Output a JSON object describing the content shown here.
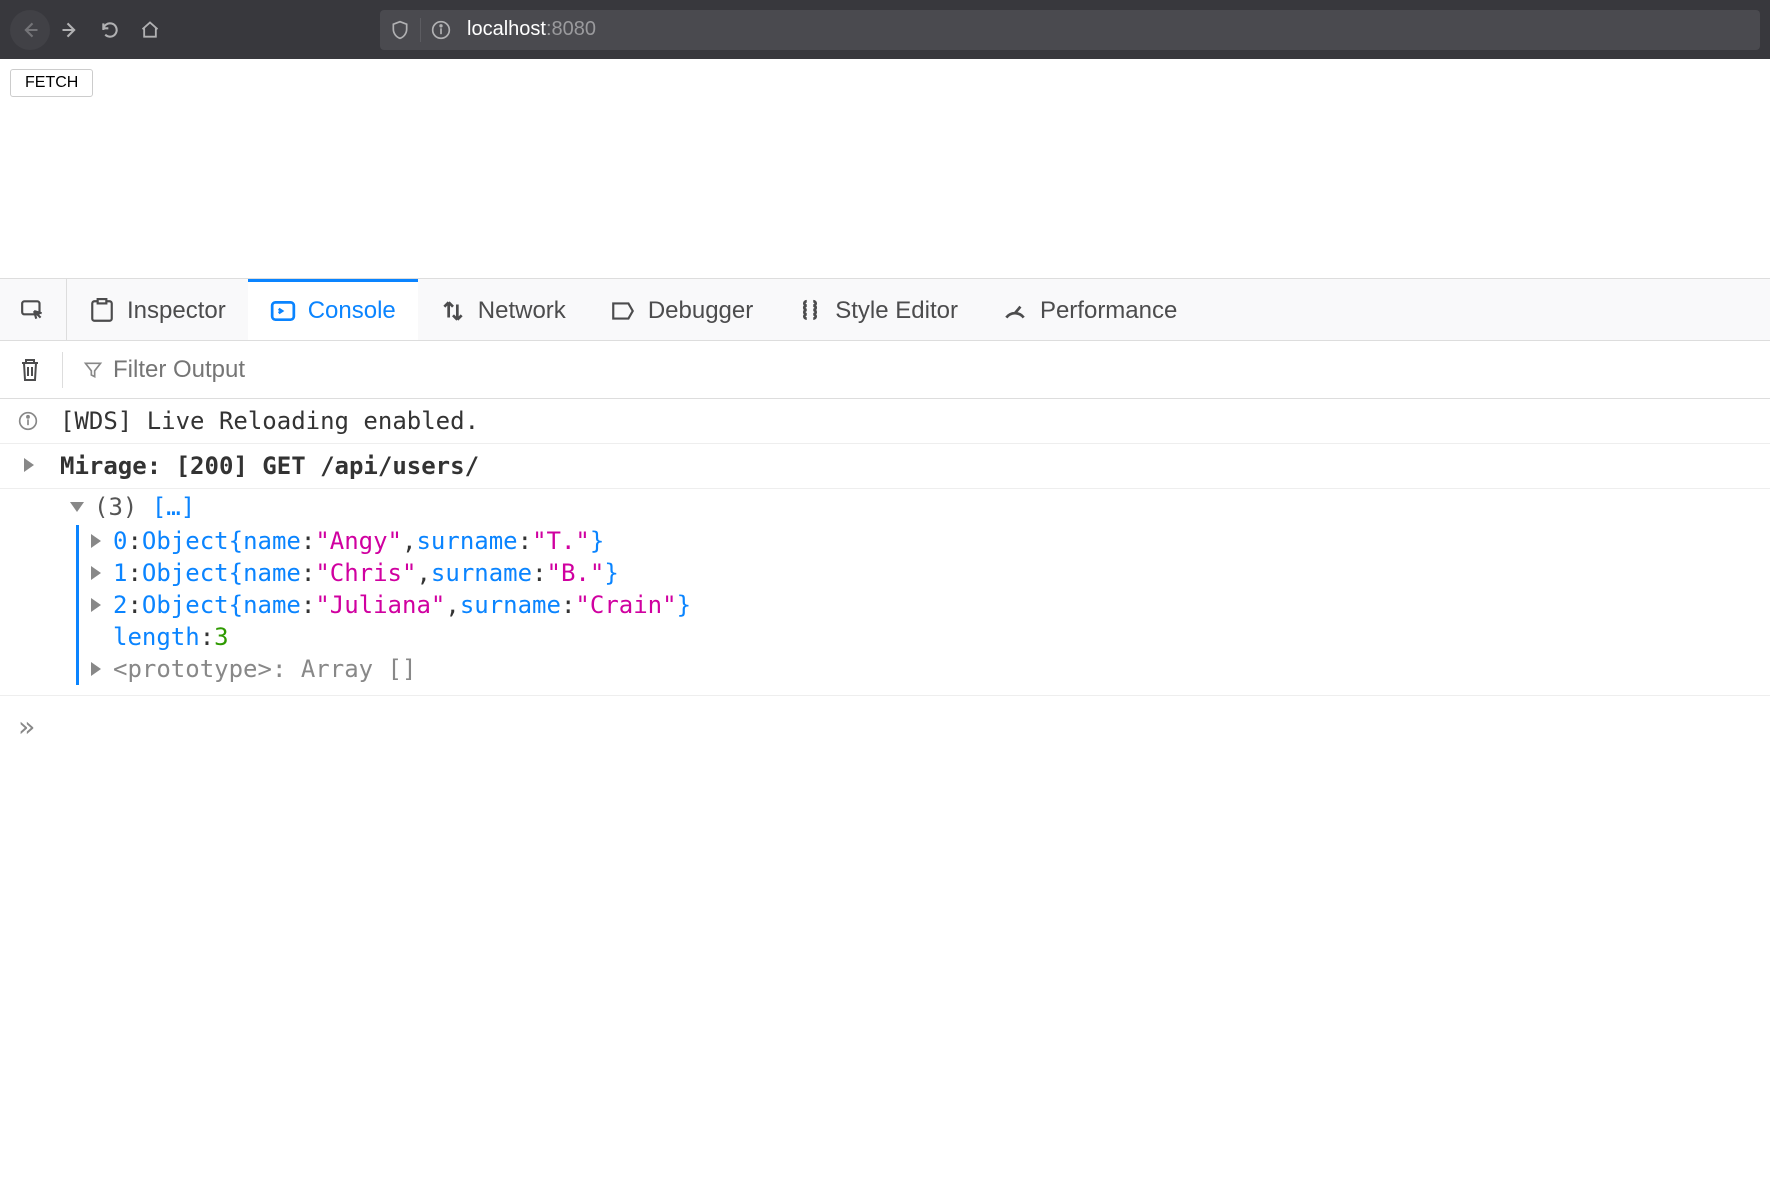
{
  "browser": {
    "url_host": "localhost",
    "url_port": ":8080"
  },
  "page": {
    "fetch_button": "FETCH"
  },
  "devtools": {
    "tabs": {
      "inspector": "Inspector",
      "console": "Console",
      "network": "Network",
      "debugger": "Debugger",
      "style_editor": "Style Editor",
      "performance": "Performance"
    },
    "filter_placeholder": "Filter Output"
  },
  "console": {
    "info_msg": "[WDS] Live Reloading enabled.",
    "mirage_msg": "Mirage: [200] GET /api/users/",
    "array_count": "(3)",
    "array_brackets": "[…]",
    "items": [
      {
        "idx": "0",
        "name": "Angy",
        "surname": "T."
      },
      {
        "idx": "1",
        "name": "Chris",
        "surname": "B."
      },
      {
        "idx": "2",
        "name": "Juliana",
        "surname": "Crain"
      }
    ],
    "length_key": "length",
    "length_val": "3",
    "proto_label": "<prototype>",
    "proto_val": "Array []",
    "obj_word": "Object",
    "key_name": "name",
    "key_surname": "surname"
  }
}
